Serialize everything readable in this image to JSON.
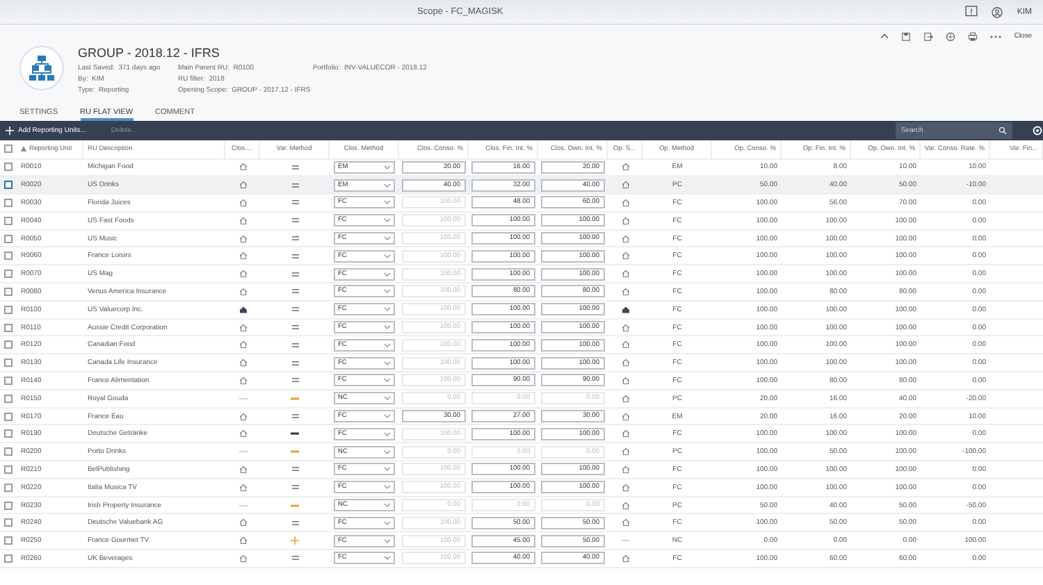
{
  "window": {
    "title": "Scope - FC_MAGISK",
    "user": "KIM",
    "close": "Close"
  },
  "header": {
    "title": "GROUP - 2018.12 - IFRS",
    "fields": [
      {
        "label": "Last Saved:",
        "value": "371 days ago"
      },
      {
        "label": "By:",
        "value": "KIM"
      },
      {
        "label": "Type:",
        "value": "Reporting"
      },
      {
        "label": "Main Parent RU:",
        "value": "R0100"
      },
      {
        "label": "RU filter:",
        "value": "2018"
      },
      {
        "label": "Opening Scope:",
        "value": "GROUP - 2017.12 - IFRS"
      },
      {
        "label": "Portfolio:",
        "value": "INV-VALUECOR - 2018.12"
      }
    ]
  },
  "tabs": [
    {
      "label": "SETTINGS",
      "selected": false
    },
    {
      "label": "RU FLAT VIEW",
      "selected": true
    },
    {
      "label": "COMMENT",
      "selected": false
    }
  ],
  "toolbar": {
    "add": "Add Reporting Units...",
    "delete": "Delete...",
    "delete_disabled": true,
    "search_placeholder": "Search"
  },
  "table": {
    "select_all_checked": false,
    "columns": [
      "Reporting Unit",
      "RU Description",
      "Clos....",
      "Var. Method",
      "Clos. Method",
      "Clos. Conso. %",
      "Clos. Fin. Int. %",
      "Clos. Own. Int. %",
      "Op. S...",
      "Op. Method",
      "Op. Conso. %",
      "Op. Fin. Int. %",
      "Op. Own. Int. %",
      "Var. Conso. Rate. %",
      "Var. Fin..."
    ],
    "rows": [
      {
        "unit": "R0010",
        "description": "Michigan Food",
        "selected": false,
        "clos_status": {
          "kind": "house"
        },
        "var_method": {
          "kind": "equal"
        },
        "clos_method": "EM",
        "conso": "20.00",
        "conso_disabled": false,
        "fin": "16.00",
        "fin_disabled": false,
        "own": "20.00",
        "own_disabled": false,
        "op_status": {
          "kind": "house"
        },
        "op_method": "EM",
        "op_conso": "10.00",
        "op_fin": "8.00",
        "op_own": "10.00",
        "var_rate": "10.00"
      },
      {
        "unit": "R0020",
        "description": "US Drinks",
        "selected": true,
        "clos_status": {
          "kind": "house"
        },
        "var_method": {
          "kind": "equal"
        },
        "clos_method": "EM",
        "conso": "40.00",
        "conso_disabled": false,
        "fin": "32.00",
        "fin_disabled": false,
        "own": "40.00",
        "own_disabled": false,
        "op_status": {
          "kind": "house"
        },
        "op_method": "PC",
        "op_conso": "50.00",
        "op_fin": "40.00",
        "op_own": "50.00",
        "var_rate": "-10.00"
      },
      {
        "unit": "R0030",
        "description": "Florida Juices",
        "selected": false,
        "clos_status": {
          "kind": "house"
        },
        "var_method": {
          "kind": "equal"
        },
        "clos_method": "FC",
        "conso": "100.00",
        "conso_disabled": true,
        "fin": "48.00",
        "fin_disabled": false,
        "own": "60.00",
        "own_disabled": false,
        "op_status": {
          "kind": "house"
        },
        "op_method": "FC",
        "op_conso": "100.00",
        "op_fin": "56.00",
        "op_own": "70.00",
        "var_rate": "0.00"
      },
      {
        "unit": "R0040",
        "description": "US Fast Foods",
        "selected": false,
        "clos_status": {
          "kind": "house"
        },
        "var_method": {
          "kind": "equal"
        },
        "clos_method": "FC",
        "conso": "100.00",
        "conso_disabled": true,
        "fin": "100.00",
        "fin_disabled": false,
        "own": "100.00",
        "own_disabled": false,
        "op_status": {
          "kind": "house"
        },
        "op_method": "FC",
        "op_conso": "100.00",
        "op_fin": "100.00",
        "op_own": "100.00",
        "var_rate": "0.00"
      },
      {
        "unit": "R0050",
        "description": "US Music",
        "selected": false,
        "clos_status": {
          "kind": "house"
        },
        "var_method": {
          "kind": "equal"
        },
        "clos_method": "FC",
        "conso": "100.00",
        "conso_disabled": true,
        "fin": "100.00",
        "fin_disabled": false,
        "own": "100.00",
        "own_disabled": false,
        "op_status": {
          "kind": "house"
        },
        "op_method": "FC",
        "op_conso": "100.00",
        "op_fin": "100.00",
        "op_own": "100.00",
        "var_rate": "0.00"
      },
      {
        "unit": "R0060",
        "description": "France Loisirs",
        "selected": false,
        "clos_status": {
          "kind": "house"
        },
        "var_method": {
          "kind": "equal"
        },
        "clos_method": "FC",
        "conso": "100.00",
        "conso_disabled": true,
        "fin": "100.00",
        "fin_disabled": false,
        "own": "100.00",
        "own_disabled": false,
        "op_status": {
          "kind": "house"
        },
        "op_method": "FC",
        "op_conso": "100.00",
        "op_fin": "100.00",
        "op_own": "100.00",
        "var_rate": "0.00"
      },
      {
        "unit": "R0070",
        "description": "US Mag",
        "selected": false,
        "clos_status": {
          "kind": "house"
        },
        "var_method": {
          "kind": "equal"
        },
        "clos_method": "FC",
        "conso": "100.00",
        "conso_disabled": true,
        "fin": "100.00",
        "fin_disabled": false,
        "own": "100.00",
        "own_disabled": false,
        "op_status": {
          "kind": "house"
        },
        "op_method": "FC",
        "op_conso": "100.00",
        "op_fin": "100.00",
        "op_own": "100.00",
        "var_rate": "0.00"
      },
      {
        "unit": "R0080",
        "description": "Venus America Insurance",
        "selected": false,
        "clos_status": {
          "kind": "house"
        },
        "var_method": {
          "kind": "equal"
        },
        "clos_method": "FC",
        "conso": "100.00",
        "conso_disabled": true,
        "fin": "80.00",
        "fin_disabled": false,
        "own": "80.00",
        "own_disabled": false,
        "op_status": {
          "kind": "house"
        },
        "op_method": "FC",
        "op_conso": "100.00",
        "op_fin": "80.00",
        "op_own": "80.00",
        "var_rate": "0.00"
      },
      {
        "unit": "R0100",
        "description": "US Valuecorp Inc.",
        "selected": false,
        "clos_status": {
          "kind": "filled"
        },
        "var_method": {
          "kind": "equal"
        },
        "clos_method": "FC",
        "conso": "100.00",
        "conso_disabled": true,
        "fin": "100.00",
        "fin_disabled": false,
        "own": "100.00",
        "own_disabled": false,
        "op_status": {
          "kind": "filled"
        },
        "op_method": "FC",
        "op_conso": "100.00",
        "op_fin": "100.00",
        "op_own": "100.00",
        "var_rate": "0.00"
      },
      {
        "unit": "R0110",
        "description": "Aussie Credit Corporation",
        "selected": false,
        "clos_status": {
          "kind": "house"
        },
        "var_method": {
          "kind": "equal"
        },
        "clos_method": "FC",
        "conso": "100.00",
        "conso_disabled": true,
        "fin": "100.00",
        "fin_disabled": false,
        "own": "100.00",
        "own_disabled": false,
        "op_status": {
          "kind": "house"
        },
        "op_method": "FC",
        "op_conso": "100.00",
        "op_fin": "100.00",
        "op_own": "100.00",
        "var_rate": "0.00"
      },
      {
        "unit": "R0120",
        "description": "Canadian Food",
        "selected": false,
        "clos_status": {
          "kind": "house"
        },
        "var_method": {
          "kind": "equal"
        },
        "clos_method": "FC",
        "conso": "100.00",
        "conso_disabled": true,
        "fin": "100.00",
        "fin_disabled": false,
        "own": "100.00",
        "own_disabled": false,
        "op_status": {
          "kind": "house"
        },
        "op_method": "FC",
        "op_conso": "100.00",
        "op_fin": "100.00",
        "op_own": "100.00",
        "var_rate": "0.00"
      },
      {
        "unit": "R0130",
        "description": "Canada Life Insurance",
        "selected": false,
        "clos_status": {
          "kind": "house"
        },
        "var_method": {
          "kind": "equal"
        },
        "clos_method": "FC",
        "conso": "100.00",
        "conso_disabled": true,
        "fin": "100.00",
        "fin_disabled": false,
        "own": "100.00",
        "own_disabled": false,
        "op_status": {
          "kind": "house"
        },
        "op_method": "FC",
        "op_conso": "100.00",
        "op_fin": "100.00",
        "op_own": "100.00",
        "var_rate": "0.00"
      },
      {
        "unit": "R0140",
        "description": "France Alimentation",
        "selected": false,
        "clos_status": {
          "kind": "house"
        },
        "var_method": {
          "kind": "equal"
        },
        "clos_method": "FC",
        "conso": "100.00",
        "conso_disabled": true,
        "fin": "90.00",
        "fin_disabled": false,
        "own": "90.00",
        "own_disabled": false,
        "op_status": {
          "kind": "house"
        },
        "op_method": "FC",
        "op_conso": "100.00",
        "op_fin": "80.00",
        "op_own": "80.00",
        "var_rate": "0.00"
      },
      {
        "unit": "R0150",
        "description": "Royal Gouda",
        "selected": false,
        "clos_status": {
          "kind": "none"
        },
        "var_method": {
          "kind": "minus"
        },
        "clos_method": "NC",
        "conso": "0.00",
        "conso_disabled": true,
        "fin": "0.00",
        "fin_disabled": true,
        "own": "0.00",
        "own_disabled": true,
        "op_status": {
          "kind": "house"
        },
        "op_method": "PC",
        "op_conso": "20.00",
        "op_fin": "16.00",
        "op_own": "40.00",
        "var_rate": "-20.00"
      },
      {
        "unit": "R0170",
        "description": "France Eau",
        "selected": false,
        "clos_status": {
          "kind": "house"
        },
        "var_method": {
          "kind": "equal"
        },
        "clos_method": "FC",
        "conso": "30.00",
        "conso_disabled": false,
        "fin": "27.00",
        "fin_disabled": false,
        "own": "30.00",
        "own_disabled": false,
        "op_status": {
          "kind": "house"
        },
        "op_method": "EM",
        "op_conso": "20.00",
        "op_fin": "16.00",
        "op_own": "20.00",
        "var_rate": "10.00"
      },
      {
        "unit": "R0190",
        "description": "Deutsche Getränke",
        "selected": false,
        "clos_status": {
          "kind": "house"
        },
        "var_method": {
          "kind": "bar"
        },
        "clos_method": "FC",
        "conso": "100.00",
        "conso_disabled": true,
        "fin": "100.00",
        "fin_disabled": false,
        "own": "100.00",
        "own_disabled": false,
        "op_status": {
          "kind": "house"
        },
        "op_method": "FC",
        "op_conso": "100.00",
        "op_fin": "100.00",
        "op_own": "100.00",
        "var_rate": "0.00"
      },
      {
        "unit": "R0200",
        "description": "Porto Drinks",
        "selected": false,
        "clos_status": {
          "kind": "none"
        },
        "var_method": {
          "kind": "minus"
        },
        "clos_method": "NC",
        "conso": "0.00",
        "conso_disabled": true,
        "fin": "0.00",
        "fin_disabled": true,
        "own": "0.00",
        "own_disabled": true,
        "op_status": {
          "kind": "house"
        },
        "op_method": "PC",
        "op_conso": "100.00",
        "op_fin": "50.00",
        "op_own": "100.00",
        "var_rate": "-100.00"
      },
      {
        "unit": "R0210",
        "description": "BelPublishing",
        "selected": false,
        "clos_status": {
          "kind": "house"
        },
        "var_method": {
          "kind": "equal"
        },
        "clos_method": "FC",
        "conso": "100.00",
        "conso_disabled": true,
        "fin": "100.00",
        "fin_disabled": false,
        "own": "100.00",
        "own_disabled": false,
        "op_status": {
          "kind": "house"
        },
        "op_method": "FC",
        "op_conso": "100.00",
        "op_fin": "100.00",
        "op_own": "100.00",
        "var_rate": "0.00"
      },
      {
        "unit": "R0220",
        "description": "Italia Musica TV",
        "selected": false,
        "clos_status": {
          "kind": "house"
        },
        "var_method": {
          "kind": "equal"
        },
        "clos_method": "FC",
        "conso": "100.00",
        "conso_disabled": true,
        "fin": "100.00",
        "fin_disabled": false,
        "own": "100.00",
        "own_disabled": false,
        "op_status": {
          "kind": "house"
        },
        "op_method": "FC",
        "op_conso": "100.00",
        "op_fin": "100.00",
        "op_own": "100.00",
        "var_rate": "0.00"
      },
      {
        "unit": "R0230",
        "description": "Irish Property Insurance",
        "selected": false,
        "clos_status": {
          "kind": "none"
        },
        "var_method": {
          "kind": "minus"
        },
        "clos_method": "NC",
        "conso": "0.00",
        "conso_disabled": true,
        "fin": "0.00",
        "fin_disabled": true,
        "own": "0.00",
        "own_disabled": true,
        "op_status": {
          "kind": "house"
        },
        "op_method": "PC",
        "op_conso": "50.00",
        "op_fin": "40.00",
        "op_own": "50.00",
        "var_rate": "-50.00"
      },
      {
        "unit": "R0240",
        "description": "Deutsche Valuebank AG",
        "selected": false,
        "clos_status": {
          "kind": "house"
        },
        "var_method": {
          "kind": "equal"
        },
        "clos_method": "FC",
        "conso": "100.00",
        "conso_disabled": true,
        "fin": "50.00",
        "fin_disabled": false,
        "own": "50.00",
        "own_disabled": false,
        "op_status": {
          "kind": "house"
        },
        "op_method": "FC",
        "op_conso": "100.00",
        "op_fin": "50.00",
        "op_own": "50.00",
        "var_rate": "0.00"
      },
      {
        "unit": "R0250",
        "description": "France Gourmet TV",
        "selected": false,
        "clos_status": {
          "kind": "house"
        },
        "var_method": {
          "kind": "plus"
        },
        "clos_method": "FC",
        "conso": "100.00",
        "conso_disabled": true,
        "fin": "45.00",
        "fin_disabled": false,
        "own": "50.00",
        "own_disabled": false,
        "op_status": {
          "kind": "none"
        },
        "op_method": "NC",
        "op_conso": "0.00",
        "op_fin": "0.00",
        "op_own": "0.00",
        "var_rate": "100.00"
      },
      {
        "unit": "R0260",
        "description": "UK Beverages",
        "selected": false,
        "clos_status": {
          "kind": "house"
        },
        "var_method": {
          "kind": "equal"
        },
        "clos_method": "FC",
        "conso": "100.00",
        "conso_disabled": true,
        "fin": "40.00",
        "fin_disabled": false,
        "own": "40.00",
        "own_disabled": false,
        "op_status": {
          "kind": "house"
        },
        "op_method": "FC",
        "op_conso": "100.00",
        "op_fin": "60.00",
        "op_own": "60.00",
        "var_rate": "0.00"
      }
    ]
  }
}
